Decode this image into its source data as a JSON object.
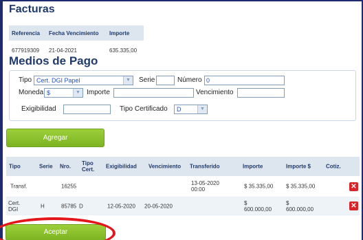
{
  "facturas": {
    "title": "Facturas",
    "headers": [
      "Referencia",
      "Fecha Vencimiento",
      "Importe"
    ],
    "row": {
      "referencia": "677919309",
      "fecha": "21-04-2021",
      "importe": "635.335,00"
    }
  },
  "medios": {
    "title": "Medios de Pago",
    "tipo_label": "Tipo",
    "tipo_value": "Cert. DGI Papel",
    "serie_label": "Serie",
    "serie_value": "",
    "numero_label": "Número",
    "numero_value": "0",
    "moneda_label": "Moneda",
    "moneda_value": "$",
    "importe_label": "Importe",
    "importe_value": "",
    "vencimiento_label": "Vencimiento",
    "vencimiento_value": "",
    "exigibilidad_label": "Exigibilidad",
    "exigibilidad_value": "",
    "tipo_cert_label": "Tipo Certificado",
    "tipo_cert_value": "D"
  },
  "buttons": {
    "agregar": "Agregar",
    "aceptar": "Aceptar"
  },
  "grid": {
    "headers": {
      "tipo": "Tipo",
      "serie": "Serie",
      "nro": "Nro.",
      "tipo_cert_1": "Tipo",
      "tipo_cert_2": "Cert.",
      "exigibilidad": "Exigibilidad",
      "vencimiento": "Vencimiento",
      "transferido": "Transferido",
      "importe": "Importe",
      "importe_usd": "Importe $",
      "cotiz": "Cotiz."
    },
    "rows": [
      {
        "tipo_1": "Transf.",
        "tipo_2": "",
        "serie": "",
        "nro": "16255",
        "tipo_cert": "",
        "exigibilidad": "",
        "vencimiento": "",
        "transferido_1": "13-05-2020",
        "transferido_2": "00:00",
        "importe_1": "$ 35.335,00",
        "importe_2": "",
        "importe_usd_1": "$ 35.335,00",
        "importe_usd_2": ""
      },
      {
        "tipo_1": "Cert.",
        "tipo_2": "DGI",
        "serie": "H",
        "nro": "85785",
        "tipo_cert": "D",
        "exigibilidad": "12-05-2020",
        "vencimiento": "20-05-2020",
        "transferido_1": "",
        "transferido_2": "",
        "importe_1": "$",
        "importe_2": "600.000,00",
        "importe_usd_1": "$",
        "importe_usd_2": "600.000,00"
      }
    ]
  },
  "icons": {
    "delete": "delete-x-icon",
    "dropdown": "chevron-down-icon"
  },
  "colors": {
    "heading": "#1f3a6b",
    "button": "#8cc232",
    "delete": "#d9252a",
    "highlight": "#e2161b"
  }
}
